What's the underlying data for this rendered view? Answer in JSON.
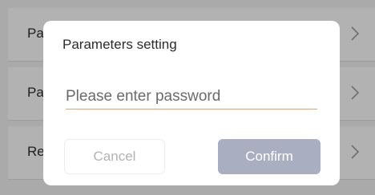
{
  "background_list": {
    "items": [
      {
        "label": "Pa"
      },
      {
        "label": "Pa"
      },
      {
        "label": "Re"
      }
    ],
    "chevron_icon": "chevron-right-icon"
  },
  "dialog": {
    "title": "Parameters setting",
    "password": {
      "value": "",
      "placeholder": "Please enter password"
    },
    "cancel_label": "Cancel",
    "confirm_label": "Confirm"
  },
  "colors": {
    "input_underline": "#e6a46c",
    "confirm_button": "#a9afc0",
    "cancel_text": "#b3b3b3",
    "overlay": "rgba(0,0,0,0.28)"
  }
}
